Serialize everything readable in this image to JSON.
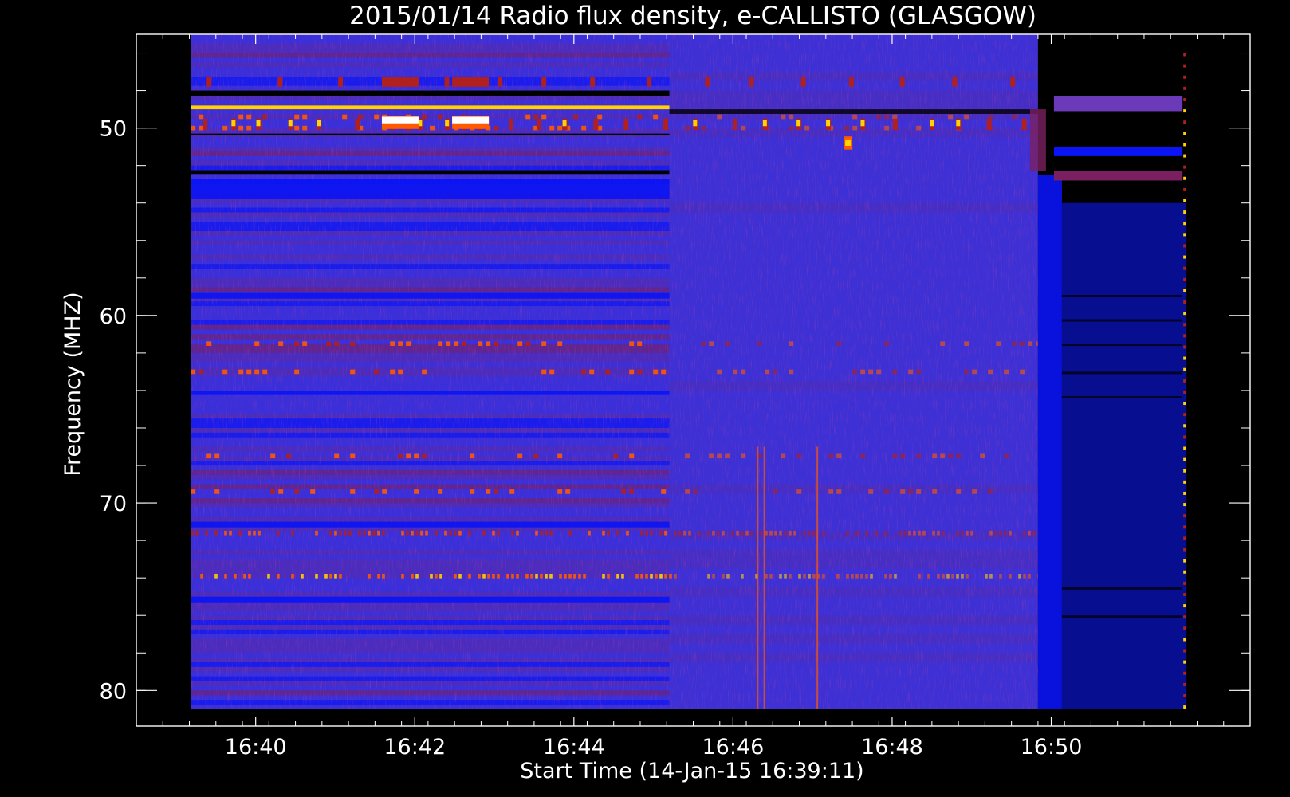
{
  "chart_data": {
    "type": "heatmap",
    "title": "2015/01/14  Radio flux density, e-CALLISTO (GLASGOW)",
    "xlabel": "Start Time (14-Jan-15 16:39:11)",
    "ylabel": "Frequency (MHZ)",
    "xlim": [
      "16:38:30",
      "16:52:30"
    ],
    "ylim": [
      45,
      81.9
    ],
    "y_inverted": true,
    "x_ticks": [
      "16:40",
      "16:42",
      "16:44",
      "16:46",
      "16:48",
      "16:50"
    ],
    "y_ticks": [
      50,
      60,
      70,
      80
    ],
    "data_time_range": [
      "16:39:11",
      "16:51:42"
    ],
    "colormap": [
      "#000000",
      "#0a14f5",
      "#5a2aa8",
      "#b0201e",
      "#ff5a00",
      "#ffd200",
      "#ffffff"
    ],
    "background_level_color": "#3a2fd8",
    "narrowband_lines_mhz": [
      48.9,
      49.4,
      50.0,
      61.5,
      63.0,
      67.5,
      69.4,
      71.6,
      73.9
    ],
    "events": [
      {
        "time": "16:41:49",
        "freq_mhz": 49.7,
        "intensity": "very high"
      },
      {
        "time": "16:42:42",
        "freq_mhz": 49.7,
        "intensity": "very high"
      },
      {
        "time": "16:47:27",
        "freq_mhz": 50.8,
        "intensity": "high"
      }
    ],
    "grid": false,
    "legend": "none"
  }
}
